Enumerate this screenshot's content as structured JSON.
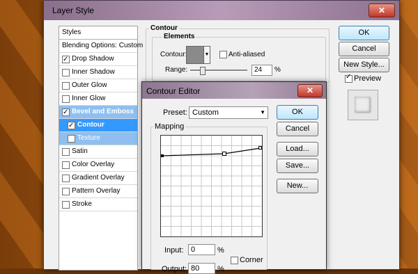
{
  "dialog": {
    "title": "Layer Style",
    "close": "✕"
  },
  "styles_list": {
    "header": "Styles",
    "items": [
      {
        "label": "Blending Options: Custom",
        "checkbox": false,
        "checked": false
      },
      {
        "label": "Drop Shadow",
        "checkbox": true,
        "checked": true
      },
      {
        "label": "Inner Shadow",
        "checkbox": true,
        "checked": false
      },
      {
        "label": "Outer Glow",
        "checkbox": true,
        "checked": false
      },
      {
        "label": "Inner Glow",
        "checkbox": true,
        "checked": false
      },
      {
        "label": "Bevel and Emboss",
        "checkbox": true,
        "checked": true
      },
      {
        "label": "Contour",
        "checkbox": true,
        "checked": true
      },
      {
        "label": "Texture",
        "checkbox": true,
        "checked": false
      },
      {
        "label": "Satin",
        "checkbox": true,
        "checked": false
      },
      {
        "label": "Color Overlay",
        "checkbox": true,
        "checked": false
      },
      {
        "label": "Gradient Overlay",
        "checkbox": true,
        "checked": false
      },
      {
        "label": "Pattern Overlay",
        "checkbox": true,
        "checked": false
      },
      {
        "label": "Stroke",
        "checkbox": true,
        "checked": false
      }
    ]
  },
  "contour_panel": {
    "title": "Contour",
    "elements_title": "Elements",
    "contour_label": "Contour:",
    "anti_aliased_label": "Anti-aliased",
    "range_label": "Range:",
    "range_value": "24",
    "range_unit": "%"
  },
  "buttons": {
    "ok": "OK",
    "cancel": "Cancel",
    "new_style": "New Style...",
    "preview": "Preview"
  },
  "contour_editor": {
    "title": "Contour Editor",
    "close": "✕",
    "preset_label": "Preset:",
    "preset_value": "Custom",
    "mapping_label": "Mapping",
    "ok": "OK",
    "cancel": "Cancel",
    "load": "Load...",
    "save": "Save...",
    "new": "New...",
    "input_label": "Input:",
    "input_value": "0",
    "input_unit": "%",
    "output_label": "Output:",
    "output_value": "80",
    "output_unit": "%",
    "corner_label": "Corner"
  }
}
